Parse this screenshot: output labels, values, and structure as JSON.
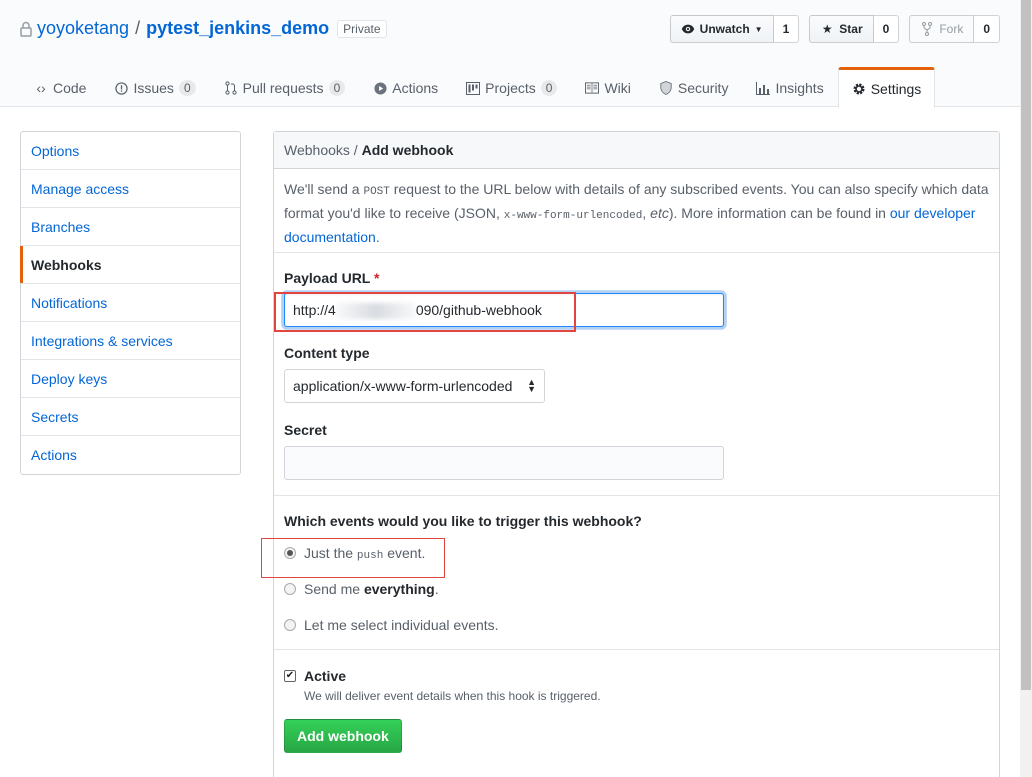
{
  "repo": {
    "owner": "yoyoketang",
    "separator": "/",
    "name": "pytest_jenkins_demo",
    "visibility": "Private"
  },
  "header_actions": {
    "watch": {
      "label": "Unwatch",
      "count": "1"
    },
    "star": {
      "label": "Star",
      "count": "0"
    },
    "fork": {
      "label": "Fork",
      "count": "0"
    }
  },
  "tabs": [
    {
      "label": "Code",
      "icon": "code-icon"
    },
    {
      "label": "Issues",
      "count": "0",
      "icon": "issue-icon"
    },
    {
      "label": "Pull requests",
      "count": "0",
      "icon": "pull-request-icon"
    },
    {
      "label": "Actions",
      "icon": "play-icon"
    },
    {
      "label": "Projects",
      "count": "0",
      "icon": "project-icon"
    },
    {
      "label": "Wiki",
      "icon": "book-icon"
    },
    {
      "label": "Security",
      "icon": "shield-icon"
    },
    {
      "label": "Insights",
      "icon": "graph-icon"
    },
    {
      "label": "Settings",
      "icon": "gear-icon",
      "selected": true
    }
  ],
  "sidebar": {
    "items": [
      {
        "label": "Options"
      },
      {
        "label": "Manage access"
      },
      {
        "label": "Branches"
      },
      {
        "label": "Webhooks",
        "selected": true
      },
      {
        "label": "Notifications"
      },
      {
        "label": "Integrations & services"
      },
      {
        "label": "Deploy keys"
      },
      {
        "label": "Secrets"
      },
      {
        "label": "Actions"
      }
    ]
  },
  "panel": {
    "breadcrumb_parent": "Webhooks",
    "breadcrumb_sep": " / ",
    "breadcrumb_current": "Add webhook",
    "intro": {
      "p1": "We'll send a ",
      "code1": "POST",
      "p2": " request to the URL below with details of any subscribed events. You can also specify which data format you'd like to receive (JSON, ",
      "code2": "x-www-form-urlencoded",
      "p3": ", ",
      "etc": "etc",
      "p4": "). More information can be found in ",
      "link": "our developer documentation",
      "p5": "."
    }
  },
  "form": {
    "payload_label": "Payload URL",
    "required_mark": "*",
    "payload_prefix": "http://4",
    "payload_suffix": "090/github-webhook",
    "content_type_label": "Content type",
    "content_type_value": "application/x-www-form-urlencoded",
    "secret_label": "Secret",
    "secret_value": "",
    "events_question": "Which events would you like to trigger this webhook?",
    "event_push_pre": "Just the ",
    "event_push_code": "push",
    "event_push_post": " event.",
    "event_all_pre": "Send me ",
    "event_all_strong": "everything",
    "event_all_post": ".",
    "event_select": "Let me select individual events.",
    "active_label": "Active",
    "active_note": "We will deliver event details when this hook is triggered.",
    "submit": "Add webhook"
  },
  "colors": {
    "link": "#0366d6",
    "accent_tab": "#e36209",
    "primary_button": "#28a745",
    "annotation_box": "#e0453f"
  }
}
